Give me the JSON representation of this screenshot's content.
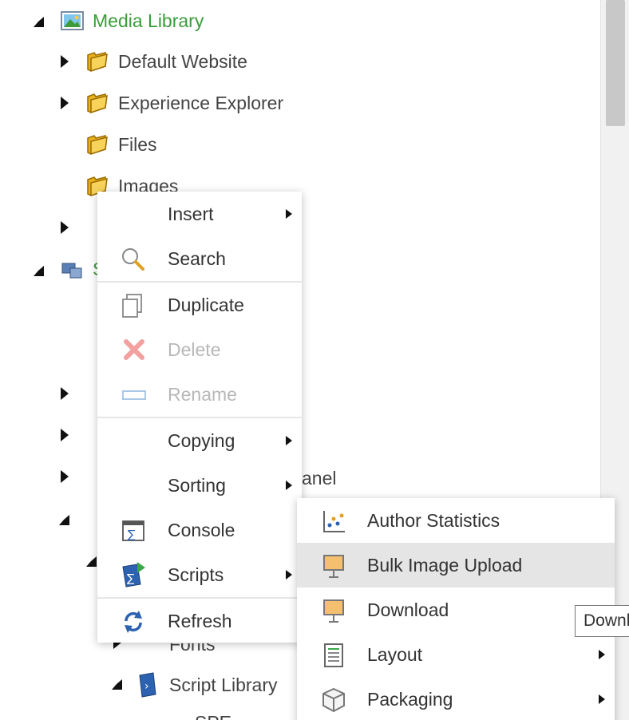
{
  "tree": {
    "root_label": "Media Library",
    "items": [
      "Default Website",
      "Experience Explorer",
      "Files",
      "Images"
    ],
    "partial_label_panel": "anel",
    "partial_s": "S",
    "fonts_label": "Fonts",
    "script_library_label": "Script Library",
    "spe_label": "SPE"
  },
  "context_menu": {
    "insert": "Insert",
    "search": "Search",
    "duplicate": "Duplicate",
    "delete": "Delete",
    "rename": "Rename",
    "copying": "Copying",
    "sorting": "Sorting",
    "console": "Console",
    "scripts": "Scripts",
    "refresh": "Refresh"
  },
  "scripts_submenu": {
    "author_statistics": "Author Statistics",
    "bulk_image_upload": "Bulk Image Upload",
    "download": "Download",
    "layout": "Layout",
    "packaging": "Packaging"
  },
  "tooltip": {
    "text": "Download"
  },
  "colors": {
    "root_label": "#3a9d3a",
    "highlight": "#e5e5e5",
    "disabled_text": "#b8b8b8"
  }
}
